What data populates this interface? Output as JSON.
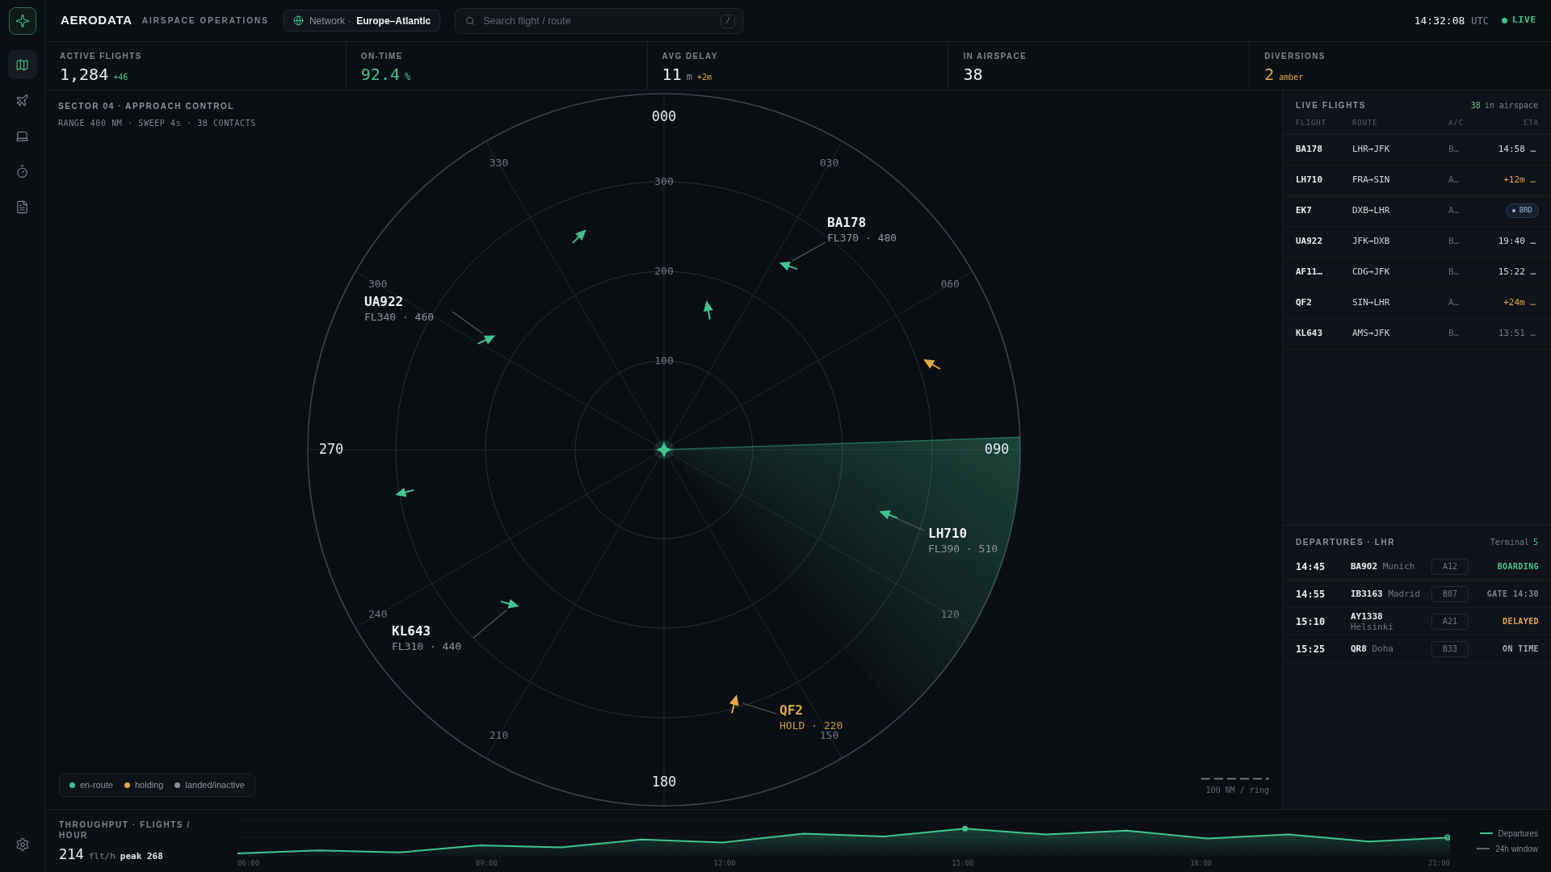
{
  "app": {
    "brand": "AERODATA",
    "subtitle": "AIRSPACE OPERATIONS"
  },
  "sidebar": {
    "nav": [
      {
        "selected": true
      },
      {
        "selected": false
      },
      {
        "selected": false
      },
      {
        "selected": false
      },
      {
        "selected": false
      }
    ]
  },
  "network": {
    "label": "Network ·",
    "value": "Europe–Atlantic"
  },
  "search": {
    "placeholder": "Search flight / route",
    "shortcut": "/"
  },
  "clock": {
    "time": "14:32:08",
    "zone": "UTC",
    "live": true,
    "live_label": "LIVE"
  },
  "kpis": [
    {
      "label": "ACTIVE FLIGHTS",
      "value": "1,284",
      "kind": "neutral",
      "delta": {
        "text": "+46",
        "kind": "good"
      }
    },
    {
      "label": "ON-TIME",
      "value": "92.4",
      "kind": "good",
      "unit": "%"
    },
    {
      "label": "AVG DELAY",
      "value": "11",
      "kind": "neutral",
      "unit": "m",
      "delta": {
        "text": "+2m",
        "kind": "warn"
      }
    },
    {
      "label": "IN AIRSPACE",
      "value": "38",
      "kind": "neutral"
    },
    {
      "label": "DIVERSIONS",
      "value": "2",
      "kind": "warn",
      "delta": {
        "text": "amber",
        "kind": "warn"
      }
    }
  ],
  "radar": {
    "title": "SECTOR 04 · APPROACH CONTROL",
    "subtitle": "RANGE 400 NM · SWEEP 4s · 38 CONTACTS",
    "bearings": [
      "000",
      "030",
      "060",
      "090",
      "120",
      "150",
      "180",
      "210",
      "240",
      "270",
      "300",
      "330"
    ],
    "rings": [
      "300",
      "200",
      "100"
    ],
    "contacts": [
      {
        "kind": "en_route"
      },
      {
        "callsign": "BA178",
        "detail": "FL370 · 480",
        "kind": "en_route"
      },
      {
        "kind": "en_route"
      },
      {
        "callsign": "UA922",
        "detail": "FL340 · 460",
        "kind": "en_route"
      },
      {
        "kind": "holding"
      },
      {
        "kind": "en_route"
      },
      {
        "callsign": "LH710",
        "detail": "FL390 · 510",
        "kind": "en_route"
      },
      {
        "callsign": "KL643",
        "detail": "FL310 · 440",
        "kind": "en_route"
      },
      {
        "callsign": "QF2",
        "detail": "HOLD · 220",
        "kind": "holding"
      }
    ],
    "legend": [
      {
        "label": "en-route",
        "color": "#41c48f"
      },
      {
        "label": "holding",
        "color": "#e0a84a"
      },
      {
        "label": "landed/inactive",
        "color": "#868e99"
      }
    ],
    "scale": "100 NM / ring"
  },
  "live_flights": {
    "title": "LIVE FLIGHTS",
    "count": "38",
    "count_label": "in airspace",
    "columns": [
      "FLIGHT",
      "ROUTE",
      "A/C",
      "ETA"
    ],
    "rows": [
      {
        "flight": "BA178",
        "route": "LHR→JFK",
        "aircraft": "B…",
        "eta": "14:58 …",
        "kind": "scheduled"
      },
      {
        "flight": "LH710",
        "route": "FRA→SIN",
        "aircraft": "A…",
        "eta": "+12m …",
        "kind": "delayed"
      },
      {
        "flight": "EK7",
        "route": "DXB→LHR",
        "aircraft": "A…",
        "eta": "BRD",
        "kind": "badge"
      },
      {
        "flight": "UA922",
        "route": "JFK→DXB",
        "aircraft": "B…",
        "eta": "19:40 …",
        "kind": "scheduled"
      },
      {
        "flight": "AF11…",
        "route": "CDG→JFK",
        "aircraft": "B…",
        "eta": "15:22 …",
        "kind": "scheduled"
      },
      {
        "flight": "QF2",
        "route": "SIN→LHR",
        "aircraft": "A…",
        "eta": "+24m …",
        "kind": "delayed"
      },
      {
        "flight": "KL643",
        "route": "AMS→JFK",
        "aircraft": "B…",
        "eta": "13:51 …",
        "kind": "landed"
      }
    ]
  },
  "departures": {
    "title": "DEPARTURES · LHR",
    "terminal_label": "Terminal",
    "terminal": "5",
    "rows": [
      {
        "time": "14:45",
        "flight": "BA902",
        "city": "Munich",
        "gate": "A12",
        "status": "BOARDING",
        "kind": "boarding"
      },
      {
        "time": "14:55",
        "flight": "IB3163",
        "city": "Madrid",
        "gate": "B07",
        "status": "GATE 14:30",
        "kind": "gate"
      },
      {
        "time": "15:10",
        "flight": "AY1338",
        "city": "Helsinki",
        "gate": "A21",
        "status": "DELAYED",
        "kind": "delayed"
      },
      {
        "time": "15:25",
        "flight": "QR8",
        "city": "Doha",
        "gate": "B33",
        "status": "ON TIME",
        "kind": "on_time"
      }
    ]
  },
  "throughput": {
    "title": "THROUGHPUT · FLIGHTS / HOUR",
    "value": "214",
    "unit": "flt/h",
    "peak": "peak 268",
    "time_labels": [
      "06:00",
      "09:00",
      "12:00",
      "15:00",
      "18:00",
      "21:00"
    ],
    "legend": [
      {
        "label": "Departures",
        "kind": "primary"
      },
      {
        "label": "24h window",
        "kind": "window"
      }
    ]
  }
}
